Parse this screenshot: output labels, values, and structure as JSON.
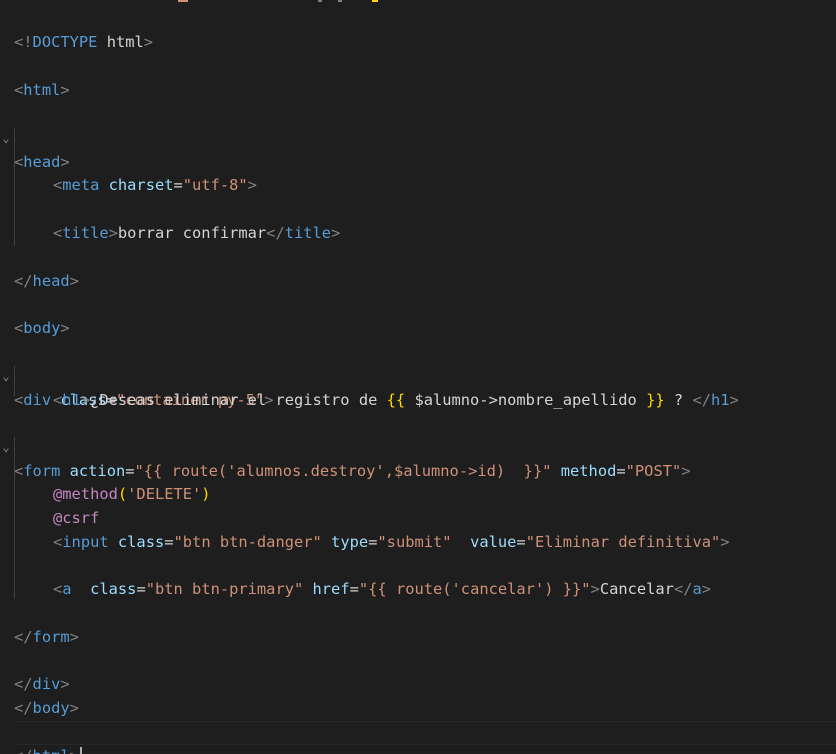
{
  "editor": {
    "language": "blade-html",
    "colors": {
      "background": "#1e1e1e",
      "tag": "#569cd6",
      "punctuation": "#808080",
      "attribute": "#9cdcfe",
      "string": "#ce9178",
      "text": "#d4d4d4",
      "blade_brace": "#ffd700",
      "blade_directive": "#c586c0"
    },
    "lines": {
      "l1": {
        "open": "<!",
        "tag": "DOCTYPE",
        "text": " html",
        "close": ">"
      },
      "l2": {
        "open": "<",
        "tag": "html",
        "close": ">"
      },
      "l3": {
        "open": "<",
        "tag": "head",
        "close": ">"
      },
      "l4": {
        "open": "<",
        "tag": "meta",
        "attr": " charset",
        "eq": "=",
        "val": "\"utf-8\"",
        "close": ">"
      },
      "l5": {
        "open": "<",
        "tag": "title",
        "close": ">",
        "text": "borrar confirmar",
        "open2": "</",
        "tag2": "title",
        "close2": ">"
      },
      "l6": {
        "open": "</",
        "tag": "head",
        "close": ">"
      },
      "l7": {
        "open": "<",
        "tag": "body",
        "close": ">"
      },
      "l8": {
        "open": "<",
        "tag": "div",
        "attr": " class",
        "eq": "=",
        "val": "\"container py-5\"",
        "close": ">"
      },
      "l9": {
        "open": "<",
        "tag": "h1",
        "close": ">",
        "text": "¿Deseas eliminar el registro de ",
        "brace_open": "{{",
        "expr": " $alumno->nombre_apellido ",
        "brace_close": "}}",
        "text2": " ? ",
        "open2": "</",
        "tag2": "h1",
        "close2": ">"
      },
      "l10": {
        "open": "<",
        "tag": "form",
        "attr": " action",
        "eq": "=",
        "val": "\"{{ route('alumnos.destroy',$alumno->id)  }}\"",
        "attr2": " method",
        "eq2": "=",
        "val2": "\"POST\"",
        "close": ">"
      },
      "l11": {
        "directive": "@method",
        "paren_open": "(",
        "arg": "'DELETE'",
        "paren_close": ")"
      },
      "l12": {
        "directive": "@csrf"
      },
      "l13": {
        "open": "<",
        "tag": "input",
        "attr": " class",
        "eq": "=",
        "val": "\"btn btn-danger\"",
        "attr2": " type",
        "eq2": "=",
        "val2": "\"submit\"",
        "attr3": "  value",
        "eq3": "=",
        "val3": "\"Eliminar definitiva\"",
        "close": ">"
      },
      "l14": {
        "open": "<",
        "tag": "a",
        "attr": "  class",
        "eq": "=",
        "val": "\"btn btn-primary\"",
        "attr2": " href",
        "eq2": "=",
        "val2": "\"{{ route('cancelar') }}\"",
        "close": ">",
        "text": "Cancelar",
        "open2": "</",
        "tag2": "a",
        "close2": ">"
      },
      "l15": {
        "open": "</",
        "tag": "form",
        "close": ">"
      },
      "l16": {
        "open": "</",
        "tag": "div",
        "close": ">"
      },
      "l17": {
        "open": "</",
        "tag": "body",
        "close": ">"
      },
      "l18": {
        "open": "</",
        "tag": "html",
        "close": ">"
      }
    }
  }
}
